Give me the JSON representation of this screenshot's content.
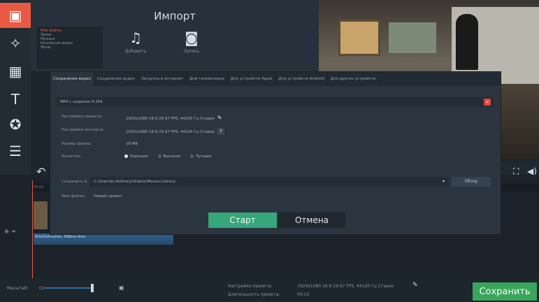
{
  "import": {
    "title": "Импорт",
    "files_list": [
      "Мои файлы",
      "Звуки",
      "Музыка",
      "Коллекция видео",
      "Фоны"
    ],
    "add_label": "Добавить",
    "record_label": "Запись"
  },
  "player": {
    "fullscreen_icon": "expand-icon",
    "volume_icon": "speaker-icon"
  },
  "dialog": {
    "tabs": [
      "Сохранение видео",
      "Сохранение аудио",
      "Загрузка в интернет",
      "Для телевизоров",
      "Для устройств Apple",
      "Для устройств Android",
      "Для других устройств"
    ],
    "format": "MP4 с кодеком H.264",
    "close_label": "×",
    "project_settings_label": "Настройки проекта:",
    "project_settings_value": "1920x1080 16:9 29.97 FPS, 44100 Гц Стерео",
    "export_settings_label": "Настройки экспорта:",
    "export_settings_value": "1920x1080 16:9 29.97 FPS, 44100 Гц Стерео",
    "help_label": "?",
    "file_size_label": "Размер файла:",
    "file_size_value": "18 МБ",
    "quality_label": "Качество:",
    "quality_options": [
      "Хорошее",
      "Высокое",
      "Лучшее"
    ],
    "save_to_label": "Сохранить в:",
    "save_to_value": "C:\\Users\\kr.Anthony\\Videos\\Movavi Library",
    "browse_label": "Обзор",
    "filename_label": "Имя файла:",
    "filename_value": "Новый проект",
    "start_label": "Старт",
    "cancel_label": "Отмена"
  },
  "timeline": {
    "ruler_start": "00:00",
    "audio_clip_title": "Arts/Instruction, Wilkins Amy"
  },
  "bottom": {
    "zoom_label": "Масштаб:",
    "project_settings_label": "Настройки проекта:",
    "project_settings_value": "1920x1080 16:9 29.97 FPS, 44100 Гц Стерео",
    "duration_label": "Длительность проекта:",
    "duration_value": "00:10",
    "save_label": "Сохранить"
  },
  "colors": {
    "accent": "#e85a43",
    "start": "#36a67b",
    "save": "#3aa55c"
  }
}
